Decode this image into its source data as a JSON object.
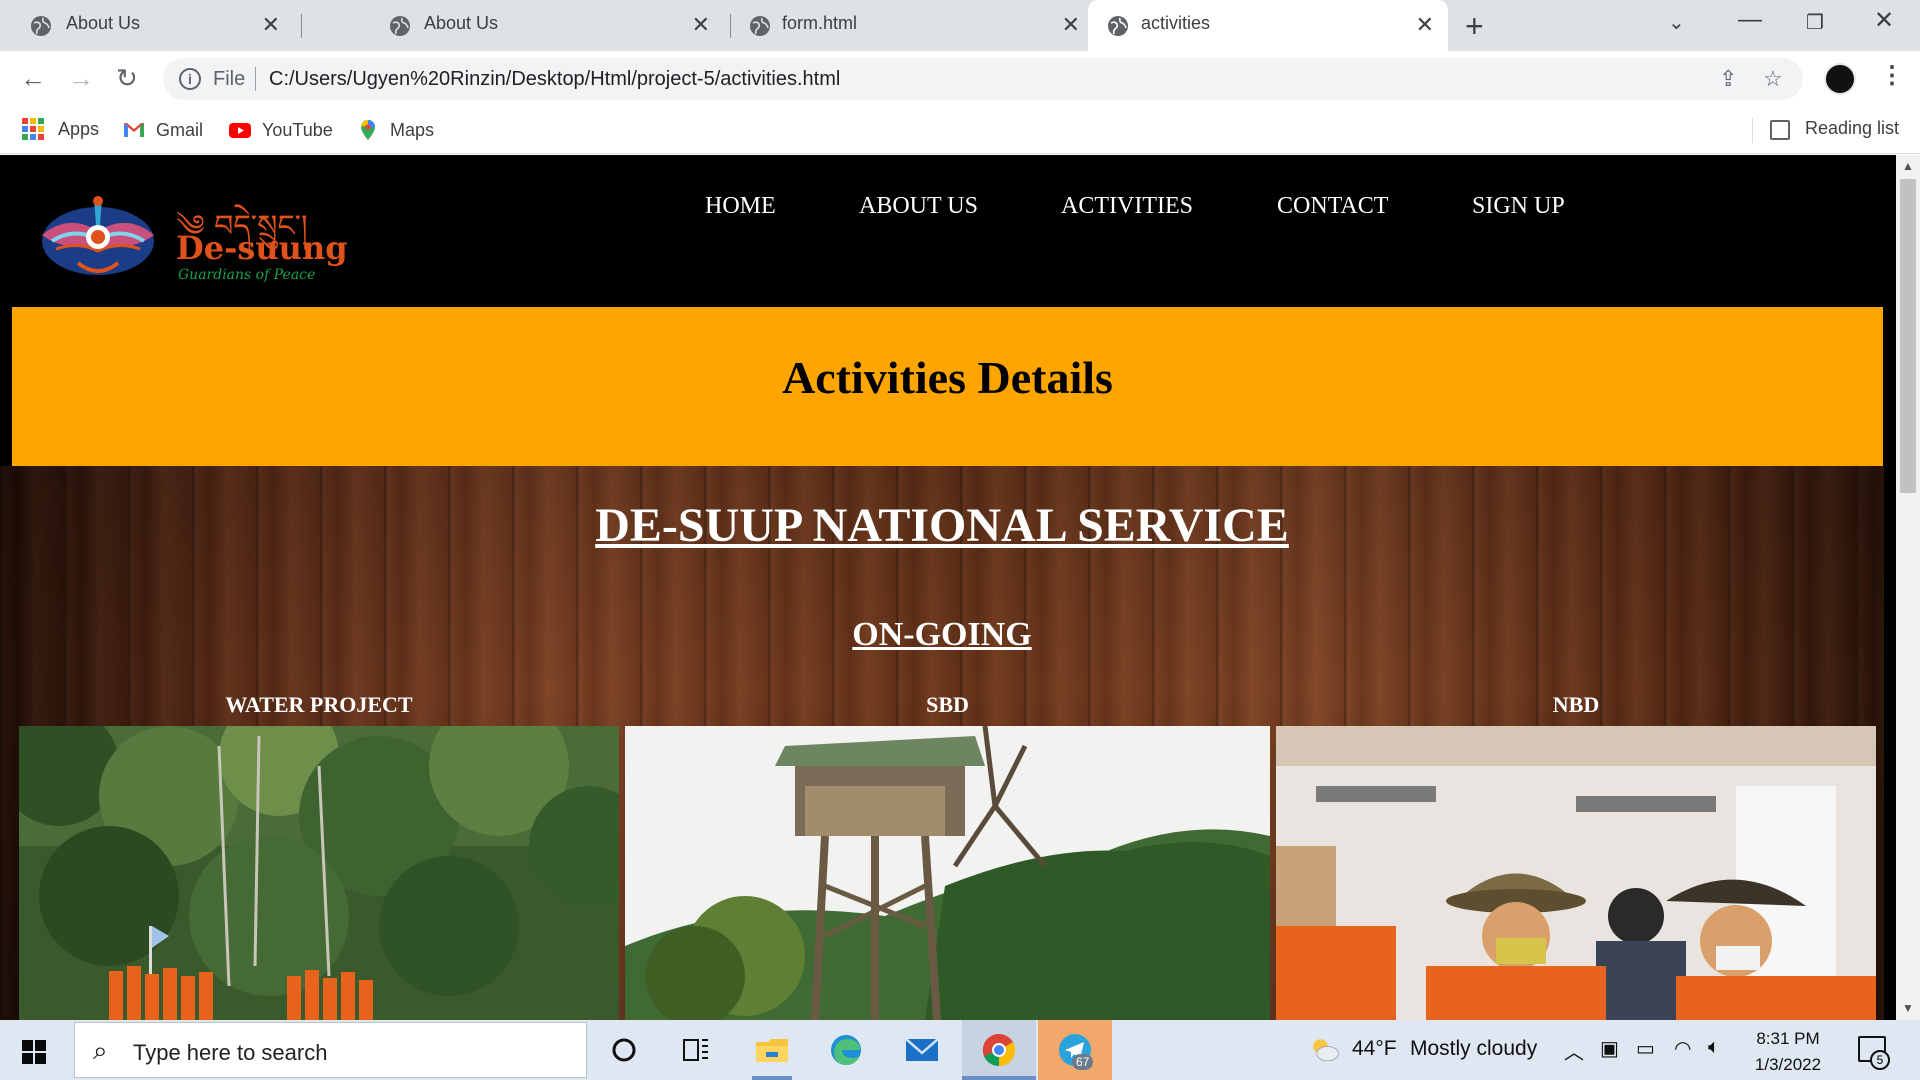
{
  "browser": {
    "tabs": [
      {
        "title": "About Us",
        "active": false
      },
      {
        "title": "About Us",
        "active": false
      },
      {
        "title": "form.html",
        "active": false
      },
      {
        "title": "activities",
        "active": true
      }
    ],
    "address": {
      "scheme_label": "File",
      "url": "C:/Users/Ugyen%20Rinzin/Desktop/Html/project-5/activities.html"
    },
    "bookmarks": [
      {
        "label": "Apps",
        "icon": "apps-grid-icon"
      },
      {
        "label": "Gmail",
        "icon": "gmail-icon"
      },
      {
        "label": "YouTube",
        "icon": "youtube-icon"
      },
      {
        "label": "Maps",
        "icon": "maps-icon"
      }
    ],
    "reading_list": "Reading list"
  },
  "site": {
    "logo": {
      "tibetan": "༄ བདེ་སྲུང་།",
      "name": "De-suung",
      "tagline": "Guardians of Peace"
    },
    "nav": [
      "HOME",
      "ABOUT US",
      "ACTIVITIES",
      "CONTACT",
      "SIGN UP"
    ],
    "banner_title": "Activities Details",
    "section_title": "DE-SUUP NATIONAL SERVICE",
    "subsection_title": "ON-GOING",
    "cards": [
      {
        "title": "WATER PROJECT"
      },
      {
        "title": "SBD"
      },
      {
        "title": "NBD"
      }
    ],
    "colors": {
      "banner": "#ffa500",
      "header": "#000000",
      "logo_orange": "#e0521b",
      "logo_green": "#18a14b"
    }
  },
  "taskbar": {
    "search_placeholder": "Type here to search",
    "weather": {
      "temp": "44°F",
      "condition": "Mostly cloudy"
    },
    "telegram_badge": "67",
    "clock": {
      "time": "8:31 PM",
      "date": "1/3/2022"
    },
    "notification_count": "5"
  }
}
